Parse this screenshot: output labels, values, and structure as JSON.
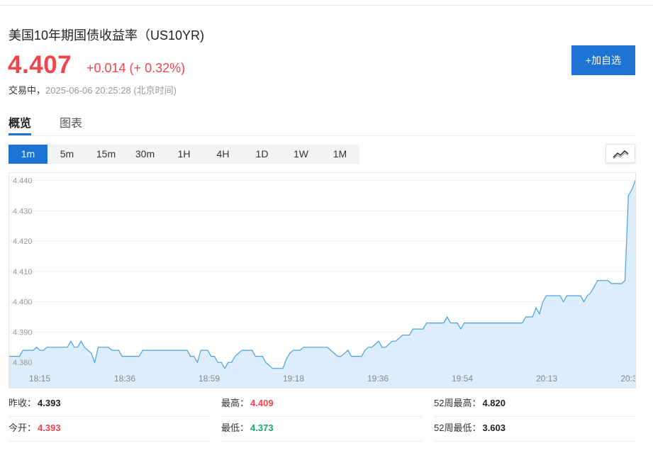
{
  "header": {
    "title": "美国10年期国债收益率（US10YR)",
    "price": "4.407",
    "change": "+0.014 (+ 0.32%)",
    "status_label": "交易中，",
    "timestamp": "2025-06-06 20:25:28 (北京时间)",
    "add_button": "+加自选"
  },
  "tabs": [
    {
      "label": "概览",
      "active": true
    },
    {
      "label": "图表",
      "active": false
    }
  ],
  "intervals": [
    {
      "label": "1m",
      "active": true
    },
    {
      "label": "5m",
      "active": false
    },
    {
      "label": "15m",
      "active": false
    },
    {
      "label": "30m",
      "active": false
    },
    {
      "label": "1H",
      "active": false
    },
    {
      "label": "4H",
      "active": false
    },
    {
      "label": "1D",
      "active": false
    },
    {
      "label": "1W",
      "active": false
    },
    {
      "label": "1M",
      "active": false
    }
  ],
  "chart_type_icon": "line-chart-icon",
  "colors": {
    "accent": "#1e73d2",
    "up": "#f0454f",
    "down": "#1aa67a",
    "line": "#4a9fe0",
    "fill": "#dcedfb"
  },
  "chart_data": {
    "type": "area",
    "ylim": [
      4.377,
      4.442
    ],
    "yticks": [
      "4.440",
      "4.430",
      "4.420",
      "4.410",
      "4.400",
      "4.390",
      "4.380"
    ],
    "xticks": [
      "18:15",
      "18:36",
      "18:59",
      "19:18",
      "19:36",
      "19:54",
      "20:13",
      "20:3"
    ],
    "grid": true,
    "values": [
      4.382,
      4.382,
      4.382,
      4.382,
      4.384,
      4.384,
      4.384,
      4.384,
      4.385,
      4.384,
      4.384,
      4.385,
      4.385,
      4.385,
      4.385,
      4.385,
      4.385,
      4.385,
      4.387,
      4.385,
      4.385,
      4.387,
      4.385,
      4.384,
      4.383,
      4.38,
      4.385,
      4.385,
      4.385,
      4.385,
      4.384,
      4.384,
      4.384,
      4.382,
      4.382,
      4.382,
      4.382,
      4.382,
      4.382,
      4.384,
      4.384,
      4.384,
      4.384,
      4.384,
      4.384,
      4.384,
      4.384,
      4.384,
      4.384,
      4.384,
      4.384,
      4.384,
      4.384,
      4.382,
      4.382,
      4.38,
      4.384,
      4.384,
      4.384,
      4.382,
      4.382,
      4.38,
      4.38,
      4.378,
      4.38,
      4.38,
      4.382,
      4.383,
      4.384,
      4.384,
      4.384,
      4.384,
      4.382,
      4.382,
      4.382,
      4.38,
      4.379,
      4.378,
      4.378,
      4.378,
      4.378,
      4.381,
      4.383,
      4.384,
      4.384,
      4.384,
      4.385,
      4.385,
      4.385,
      4.385,
      4.385,
      4.385,
      4.385,
      4.385,
      4.384,
      4.383,
      4.382,
      4.382,
      4.383,
      4.384,
      4.382,
      4.382,
      4.382,
      4.382,
      4.384,
      4.385,
      4.385,
      4.386,
      4.387,
      4.385,
      4.385,
      4.386,
      4.387,
      4.387,
      4.388,
      4.389,
      4.389,
      4.389,
      4.391,
      4.391,
      4.391,
      4.391,
      4.393,
      4.393,
      4.393,
      4.393,
      4.393,
      4.393,
      4.395,
      4.393,
      4.393,
      4.393,
      4.391,
      4.393,
      4.393,
      4.393,
      4.393,
      4.393,
      4.393,
      4.393,
      4.393,
      4.393,
      4.393,
      4.393,
      4.393,
      4.393,
      4.393,
      4.393,
      4.393,
      4.393,
      4.393,
      4.395,
      4.395,
      4.395,
      4.398,
      4.396,
      4.4,
      4.402,
      4.402,
      4.402,
      4.402,
      4.402,
      4.4,
      4.402,
      4.402,
      4.402,
      4.402,
      4.402,
      4.4,
      4.402,
      4.403,
      4.405,
      4.407,
      4.407,
      4.407,
      4.407,
      4.406,
      4.406,
      4.406,
      4.406,
      4.407,
      4.435,
      4.437,
      4.44
    ]
  },
  "stats": [
    {
      "label": "昨收：",
      "value": "4.393",
      "color": "normal"
    },
    {
      "label": "最高：",
      "value": "4.409",
      "color": "red"
    },
    {
      "label": "52周最高：",
      "value": "4.820",
      "color": "normal"
    },
    {
      "label": "今开：",
      "value": "4.393",
      "color": "red"
    },
    {
      "label": "最低：",
      "value": "4.373",
      "color": "green"
    },
    {
      "label": "52周最低：",
      "value": "3.603",
      "color": "normal"
    }
  ]
}
